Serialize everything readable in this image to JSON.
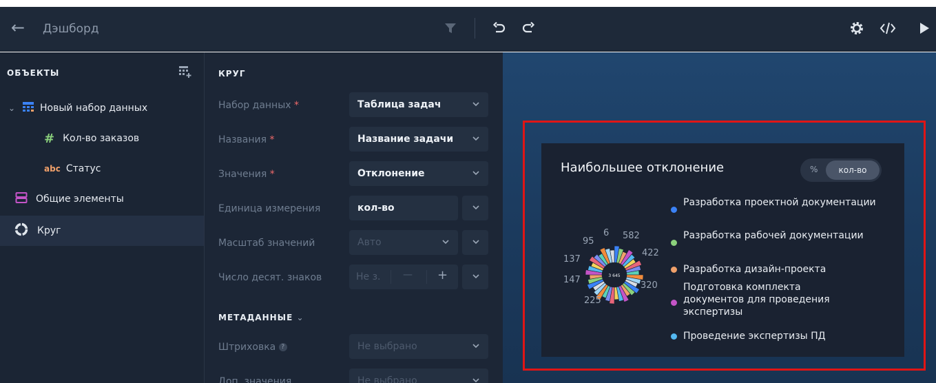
{
  "header": {
    "title": "Дэшборд",
    "icons": [
      "back-arrow-icon",
      "filter-icon",
      "undo-icon",
      "redo-icon",
      "gear-icon",
      "code-icon",
      "play-icon"
    ]
  },
  "objects": {
    "title": "ОБЪЕКТЫ",
    "items": [
      {
        "label": "Новый набор данных",
        "icon": "dataset-icon"
      },
      {
        "label": "Кол-во заказов",
        "icon": "hash-icon"
      },
      {
        "label": "Статус",
        "icon": "abc-icon"
      },
      {
        "label": "Общие элементы",
        "icon": "layout-icon"
      },
      {
        "label": "Круг",
        "icon": "donut-icon"
      }
    ]
  },
  "props": {
    "title": "КРУГ",
    "rows": [
      {
        "label": "Набор данных",
        "required": "*",
        "value": "Таблица задач"
      },
      {
        "label": "Названия",
        "required": "*",
        "value": "Название задачи"
      },
      {
        "label": "Значения",
        "required": "*",
        "value": "Отклонение"
      },
      {
        "label": "Единица измерения",
        "value": "кол-во"
      },
      {
        "label": "Масштаб значений",
        "value": "Авто"
      },
      {
        "label": "Число десят. знаков",
        "value": "Не з.",
        "minus": "—",
        "plus": "+"
      }
    ],
    "meta_title": "МЕТАДАННЫЕ",
    "meta_rows": [
      {
        "label": "Штриховка",
        "value": "Не выбрано"
      },
      {
        "label": "Доп. значения",
        "value": "Не выбрано"
      }
    ]
  },
  "widget": {
    "title": "Наибольшее отклонение",
    "toggle": {
      "off": "%",
      "on": "кол-во"
    },
    "center_total": "3 645",
    "data_labels": [
      "6",
      "582",
      "95",
      "422",
      "137",
      "147",
      "320",
      "225"
    ],
    "legend": [
      {
        "label": "Разработка проектной документации",
        "color": "#3b82f6"
      },
      {
        "label": "Разработка рабочей документации",
        "color": "#8bd17c"
      },
      {
        "label": "Разработка дизайн-проекта",
        "color": "#f0a06a"
      },
      {
        "label": "Подготовка комплекта документов для проведения экспертизы",
        "color": "#c454c7"
      },
      {
        "label": "Проведение экспертизы ПД",
        "color": "#54b8f0"
      }
    ]
  },
  "colors": {
    "accent_red": "#e01515",
    "required": "#f06a6a",
    "dataset_icon": "#3b82f6",
    "hash_icon": "#8bd17c",
    "layout_icon": "#c454c7"
  }
}
